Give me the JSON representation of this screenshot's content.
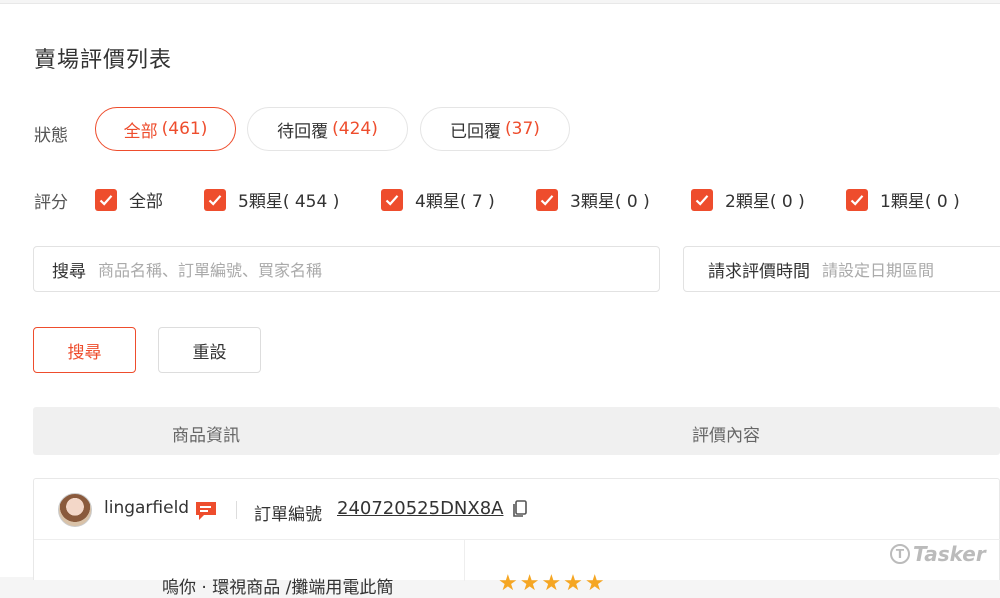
{
  "page": {
    "title": "賣場評價列表"
  },
  "status": {
    "label": "狀態",
    "tabs": [
      {
        "label": "全部",
        "count": "(461)"
      },
      {
        "label": "待回覆",
        "count": "(424)"
      },
      {
        "label": "已回覆",
        "count": "(37)"
      }
    ]
  },
  "rating": {
    "label": "評分",
    "options": [
      {
        "label": "全部",
        "checked": true
      },
      {
        "label": "5顆星( 454 )",
        "checked": true
      },
      {
        "label": "4顆星( 7 )",
        "checked": true
      },
      {
        "label": "3顆星( 0 )",
        "checked": true
      },
      {
        "label": "2顆星( 0 )",
        "checked": true
      },
      {
        "label": "1顆星( 0 )",
        "checked": true
      }
    ]
  },
  "search": {
    "label": "搜尋",
    "placeholder": "商品名稱、訂單編號、買家名稱"
  },
  "date_filter": {
    "label": "請求評價時間",
    "placeholder": "請設定日期區間"
  },
  "buttons": {
    "search": "搜尋",
    "reset": "重設"
  },
  "table": {
    "columns": [
      "商品資訊",
      "評價內容"
    ]
  },
  "order": {
    "username": "lingarfield",
    "order_label": "訂單編號",
    "order_no": "240720525DNX8A",
    "product_snippet": "嗚你 · 環視商品 /攤端用電此簡",
    "stars": "★★★★★"
  },
  "watermark": "Tasker",
  "colors": {
    "accent": "#ee4d2d",
    "star": "#f5a623"
  },
  "icons": [
    "checkbox-checked-icon",
    "chat-icon",
    "copy-icon",
    "avatar"
  ]
}
